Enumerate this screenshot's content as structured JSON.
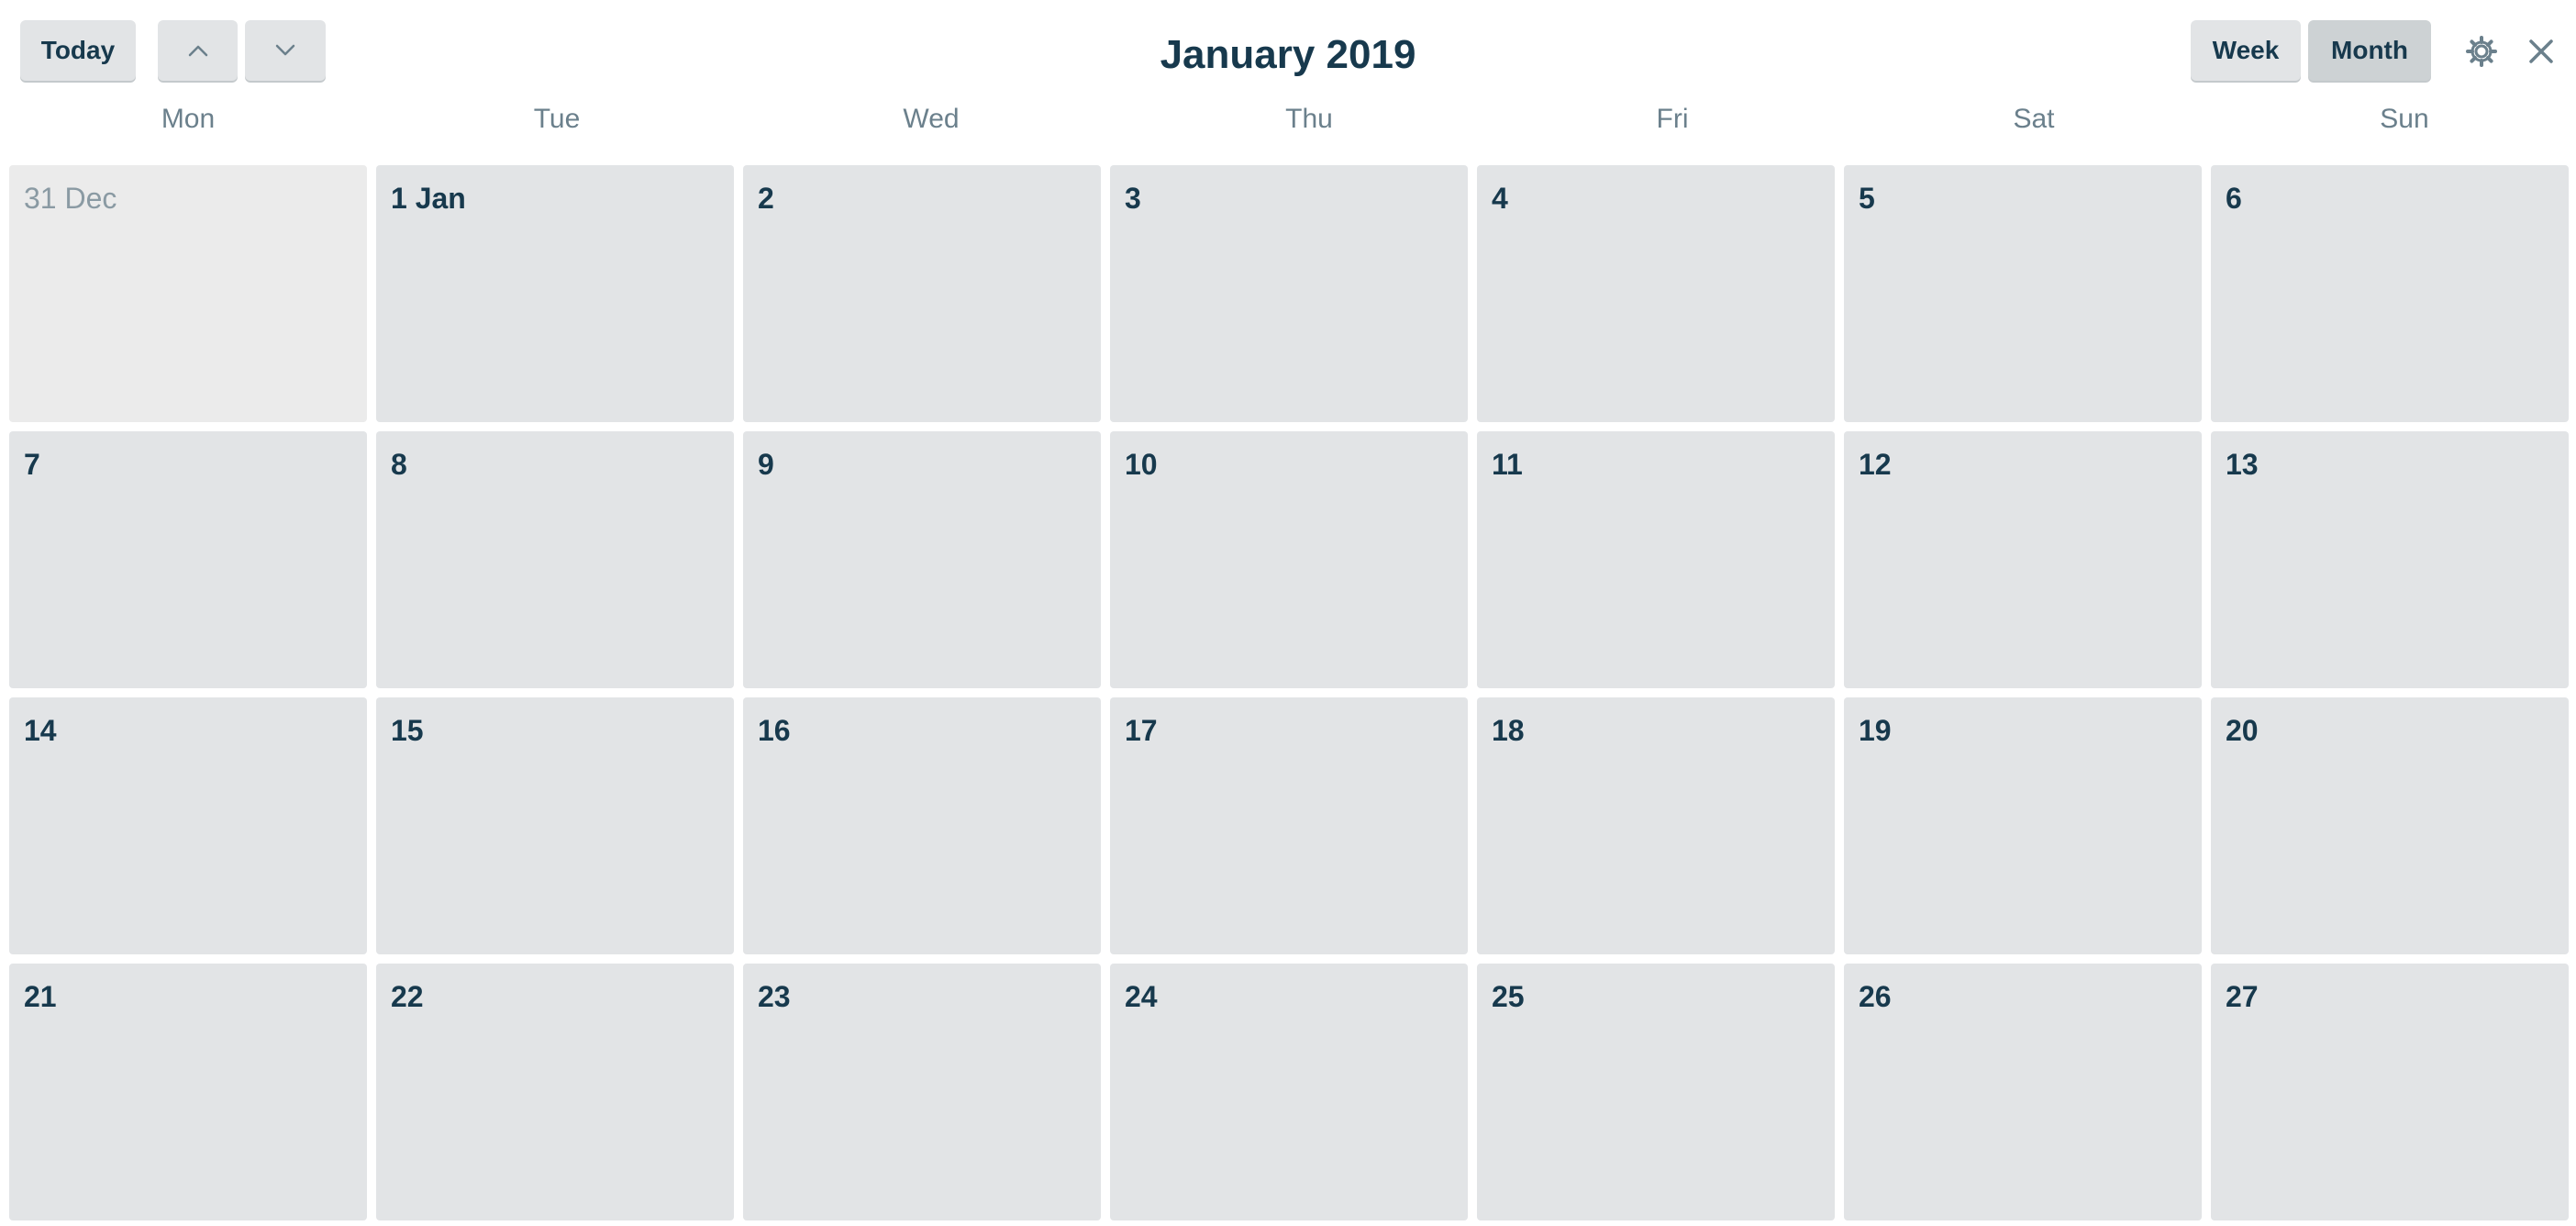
{
  "toolbar": {
    "today_label": "Today",
    "prev_icon": "chevron-up-icon",
    "next_icon": "chevron-down-icon",
    "title": "January 2019",
    "week_label": "Week",
    "month_label": "Month",
    "settings_icon": "gear-icon",
    "close_icon": "close-icon",
    "active_view": "Month"
  },
  "weekdays": [
    "Mon",
    "Tue",
    "Wed",
    "Thu",
    "Fri",
    "Sat",
    "Sun"
  ],
  "weeks": [
    [
      {
        "label": "31 Dec",
        "other": true
      },
      {
        "label": "1 Jan"
      },
      {
        "label": "2"
      },
      {
        "label": "3"
      },
      {
        "label": "4"
      },
      {
        "label": "5"
      },
      {
        "label": "6"
      }
    ],
    [
      {
        "label": "7"
      },
      {
        "label": "8"
      },
      {
        "label": "9"
      },
      {
        "label": "10"
      },
      {
        "label": "11"
      },
      {
        "label": "12"
      },
      {
        "label": "13"
      }
    ],
    [
      {
        "label": "14"
      },
      {
        "label": "15"
      },
      {
        "label": "16"
      },
      {
        "label": "17"
      },
      {
        "label": "18"
      },
      {
        "label": "19"
      },
      {
        "label": "20"
      }
    ],
    [
      {
        "label": "21"
      },
      {
        "label": "22"
      },
      {
        "label": "23"
      },
      {
        "label": "24"
      },
      {
        "label": "25"
      },
      {
        "label": "26"
      },
      {
        "label": "27"
      }
    ]
  ],
  "colors": {
    "text_primary": "#17394d",
    "text_muted": "#6b808c",
    "cell_bg": "#e2e4e6",
    "cell_other_bg": "#ebebeb",
    "button_active_bg": "#cdd2d4"
  }
}
